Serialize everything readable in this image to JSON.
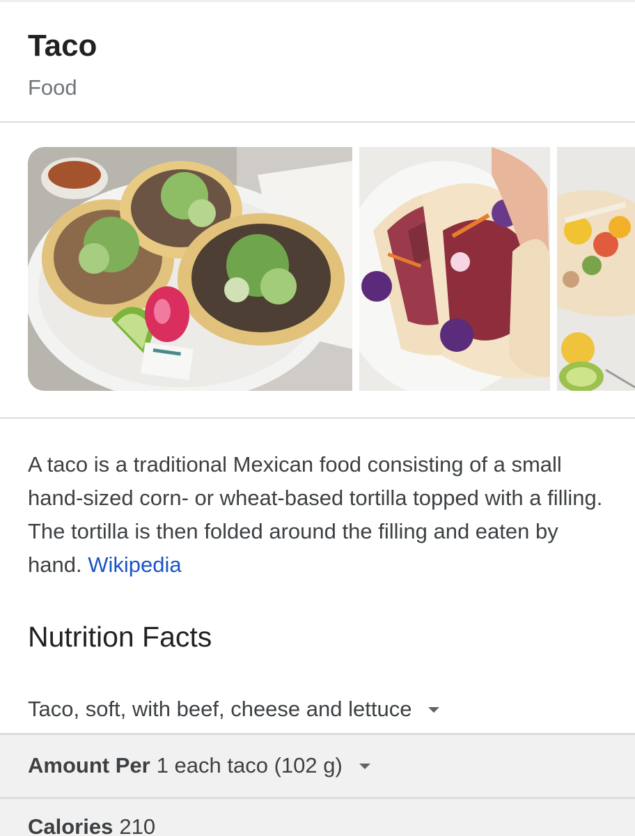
{
  "entity": {
    "title": "Taco",
    "subtitle": "Food"
  },
  "images": [
    {
      "icon": "tacos-on-plate-photo"
    },
    {
      "icon": "tuna-tacos-photo"
    },
    {
      "icon": "fish-tacos-mango-salsa-photo"
    }
  ],
  "description": {
    "text": "A taco is a traditional Mexican food consisting of a small hand-sized corn- or wheat-based tortilla topped with a filling. The tortilla is then folded around the filling and eaten by hand. ",
    "source_link": "Wikipedia"
  },
  "nutrition": {
    "heading": "Nutrition Facts",
    "food_selected": "Taco, soft, with beef, cheese and lettuce",
    "amount_label": "Amount Per",
    "amount_value": "1 each taco (102 g)",
    "calories_label": "Calories",
    "calories_value": "210"
  },
  "colors": {
    "link": "#1a55c4",
    "title": "#202124",
    "muted": "#70757a",
    "row_bg": "#f1f1f1"
  }
}
